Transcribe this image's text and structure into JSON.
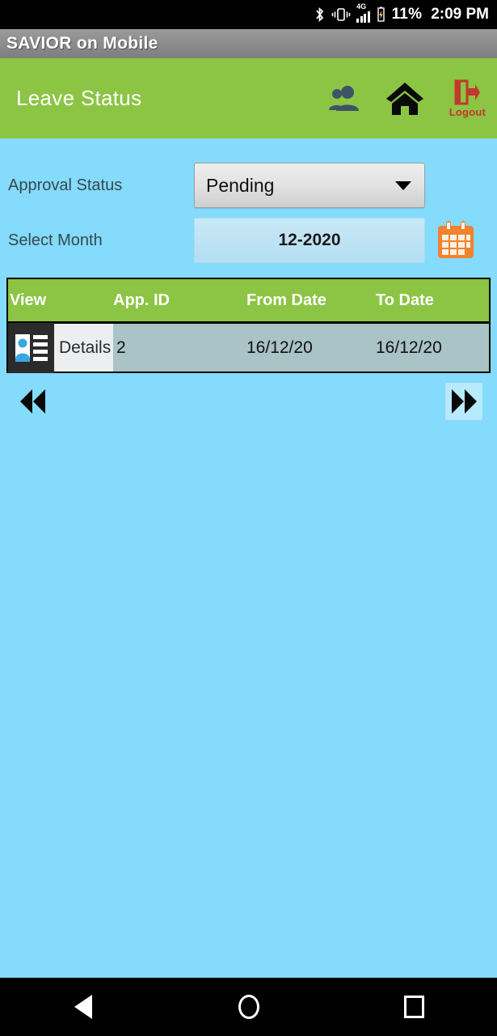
{
  "status_bar": {
    "bluetooth_icon": "bluetooth-icon",
    "vibrate_icon": "vibrate-icon",
    "network_type": "4G",
    "signal_icon": "signal-bars-icon",
    "battery_icon": "battery-charging-icon",
    "battery_percent": "11%",
    "time": "2:09 PM"
  },
  "app_bar": {
    "title": "SAVIOR on Mobile"
  },
  "header": {
    "page_title": "Leave Status",
    "contacts_icon": "contacts-icon",
    "home_icon": "home-icon",
    "logout_icon": "logout-icon",
    "logout_label": "Logout",
    "background_color": "#8cc444"
  },
  "form": {
    "approval_status": {
      "label": "Approval Status",
      "value": "Pending",
      "caret_icon": "chevron-down-icon"
    },
    "select_month": {
      "label": "Select Month",
      "value": "12-2020",
      "calendar_icon": "calendar-icon"
    }
  },
  "table": {
    "columns": [
      "View",
      "App. ID",
      "From Date",
      "To Date"
    ],
    "rows": [
      {
        "view_label": "Details",
        "view_icon": "contact-card-icon",
        "app_id": "2",
        "from_date": "16/12/20",
        "to_date": "16/12/20"
      }
    ]
  },
  "pagination": {
    "prev_icon": "double-left-arrow-icon",
    "next_icon": "double-right-arrow-icon"
  },
  "nav_bar": {
    "back_icon": "back-triangle-icon",
    "home_icon": "home-circle-icon",
    "recents_icon": "recents-square-icon"
  },
  "colors": {
    "page_background": "#84dbfb",
    "header_green": "#8cc444",
    "row_background": "#a9c3c7",
    "logout_red": "#c0392b",
    "calendar_orange": "#ef8330"
  }
}
